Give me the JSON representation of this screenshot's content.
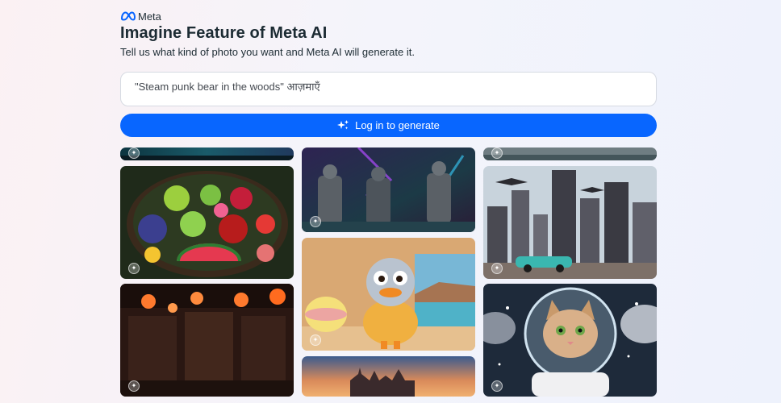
{
  "brand": {
    "name": "Meta"
  },
  "header": {
    "title": "Imagine Feature of Meta AI",
    "subtitle": "Tell us what kind of photo you want and Meta AI will generate it."
  },
  "prompt": {
    "text": "\"Steam punk bear in the woods\" आज़माएँ"
  },
  "cta": {
    "label": "Log in to generate"
  },
  "gallery": {
    "badge_icon": "sparkle-icon",
    "tiles": [
      {
        "name": "aurora-landscape-tile",
        "subject": "night sky aurora"
      },
      {
        "name": "fruit-bowl-tile",
        "subject": "fruit platter"
      },
      {
        "name": "lantern-courtyard-tile",
        "subject": "lantern-lit courtyard"
      },
      {
        "name": "space-soldiers-tile",
        "subject": "armored figures"
      },
      {
        "name": "duck-character-tile",
        "subject": "fluffy duck character"
      },
      {
        "name": "castle-sunset-tile",
        "subject": "castle at sunset"
      },
      {
        "name": "seascape-tile",
        "subject": "misty landscape"
      },
      {
        "name": "futuristic-city-tile",
        "subject": "city with flying craft"
      },
      {
        "name": "astronaut-cat-tile",
        "subject": "cat in space helmet"
      }
    ]
  },
  "colors": {
    "accent": "#0866ff",
    "title": "#1c2b33"
  }
}
